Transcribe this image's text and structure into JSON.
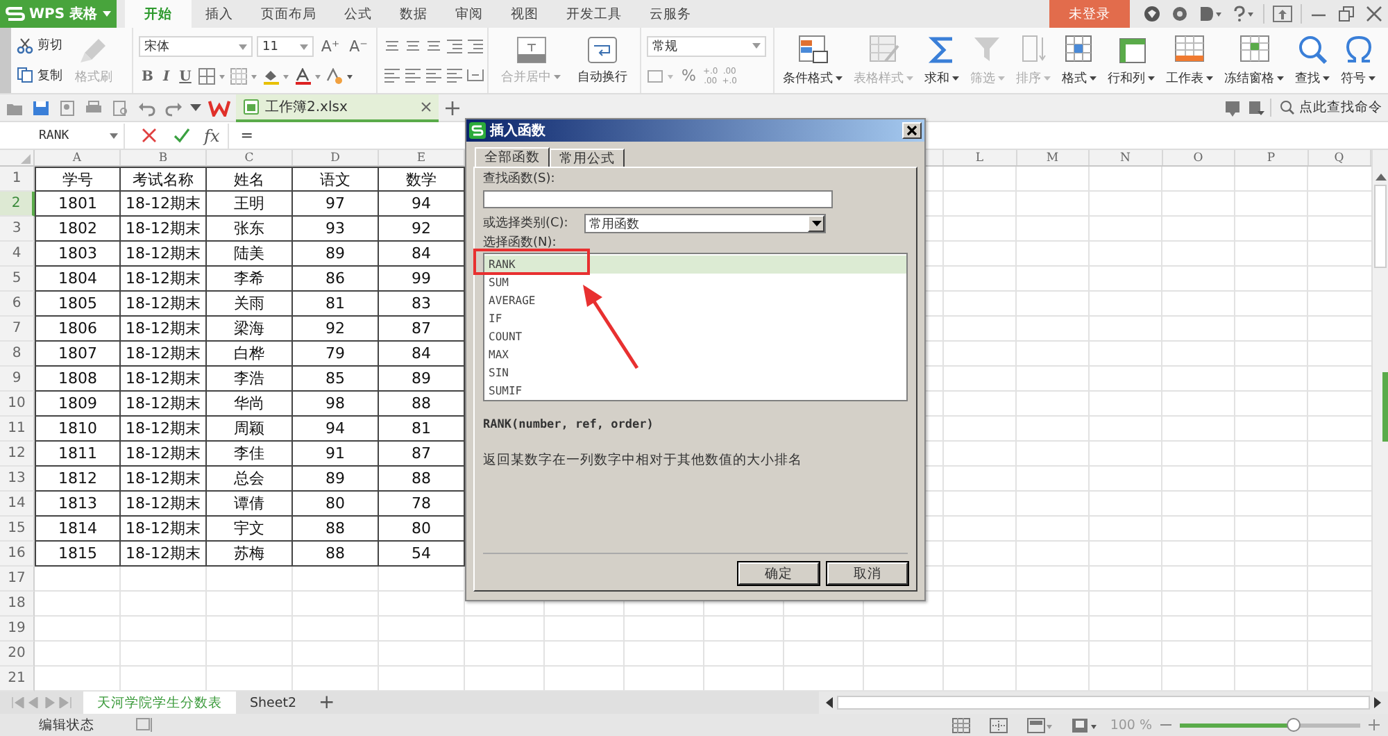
{
  "app": {
    "name": "WPS 表格"
  },
  "ribbon_tabs": [
    {
      "label": "开始",
      "selected": true
    },
    {
      "label": "插入",
      "selected": false
    },
    {
      "label": "页面布局",
      "selected": false
    },
    {
      "label": "公式",
      "selected": false
    },
    {
      "label": "数据",
      "selected": false
    },
    {
      "label": "审阅",
      "selected": false
    },
    {
      "label": "视图",
      "selected": false
    },
    {
      "label": "开发工具",
      "selected": false
    },
    {
      "label": "云服务",
      "selected": false
    }
  ],
  "account": {
    "label": "未登录"
  },
  "ribbon": {
    "clipboard": [
      {
        "label": "剪切",
        "kind": "cut",
        "disabled": false
      },
      {
        "label": "复制",
        "kind": "copy",
        "disabled": false
      }
    ],
    "format_painter": {
      "label": "格式刷",
      "disabled": true
    },
    "font": {
      "name": "宋体",
      "size": "11",
      "grow": "A⁺",
      "shrink": "A⁻"
    },
    "style_buttons": [
      "B",
      "I",
      "U"
    ],
    "merge": {
      "label": "合并居中",
      "disabled": true
    },
    "wrap": {
      "label": "自动换行",
      "disabled": false
    },
    "number": {
      "format": "常规",
      "percent": "%",
      "decimals": [
        {
          "top": "+.0",
          "bottom": ".00"
        },
        {
          "top": ".00",
          "bottom": "+.0"
        }
      ]
    },
    "tools": [
      {
        "label": "条件格式",
        "kind": "conditional",
        "disabled": false
      },
      {
        "label": "表格样式",
        "kind": "tablestyle",
        "disabled": true
      },
      {
        "label": "求和",
        "kind": "sum",
        "disabled": false
      },
      {
        "label": "筛选",
        "kind": "filter",
        "disabled": true
      },
      {
        "label": "排序",
        "kind": "sort",
        "disabled": true
      },
      {
        "label": "格式",
        "kind": "format",
        "disabled": false
      },
      {
        "label": "行和列",
        "kind": "rowcol",
        "disabled": false
      },
      {
        "label": "工作表",
        "kind": "sheet",
        "disabled": false
      },
      {
        "label": "冻结窗格",
        "kind": "freeze",
        "disabled": false
      },
      {
        "label": "查找",
        "kind": "find",
        "disabled": false
      },
      {
        "label": "符号",
        "kind": "symbol",
        "disabled": false
      }
    ],
    "command_search": {
      "placeholder": "点此查找命令"
    }
  },
  "document_tab": {
    "title": "工作簿2.xlsx"
  },
  "formula_bar": {
    "name_box": "RANK",
    "function_label": "fx",
    "formula": "="
  },
  "sheet": {
    "columns": [
      {
        "letter": "A"
      },
      {
        "letter": "B"
      },
      {
        "letter": "C"
      },
      {
        "letter": "D"
      },
      {
        "letter": "E"
      }
    ],
    "right_columns": [
      {
        "letter": "L"
      },
      {
        "letter": "M"
      },
      {
        "letter": "N"
      },
      {
        "letter": "O"
      },
      {
        "letter": "P"
      },
      {
        "letter": "Q"
      }
    ],
    "rows": [
      {
        "number": "1",
        "selected": false,
        "cells": [
          "学号",
          "考试名称",
          "姓名",
          "语文",
          "数学"
        ]
      },
      {
        "number": "2",
        "selected": true,
        "cells": [
          "1801",
          "18-12期末",
          "王明",
          "97",
          "94"
        ]
      },
      {
        "number": "3",
        "selected": false,
        "cells": [
          "1802",
          "18-12期末",
          "张东",
          "93",
          "92"
        ]
      },
      {
        "number": "4",
        "selected": false,
        "cells": [
          "1803",
          "18-12期末",
          "陆美",
          "89",
          "84"
        ]
      },
      {
        "number": "5",
        "selected": false,
        "cells": [
          "1804",
          "18-12期末",
          "李希",
          "86",
          "99"
        ]
      },
      {
        "number": "6",
        "selected": false,
        "cells": [
          "1805",
          "18-12期末",
          "关雨",
          "81",
          "83"
        ]
      },
      {
        "number": "7",
        "selected": false,
        "cells": [
          "1806",
          "18-12期末",
          "梁海",
          "92",
          "87"
        ]
      },
      {
        "number": "8",
        "selected": false,
        "cells": [
          "1807",
          "18-12期末",
          "白桦",
          "79",
          "84"
        ]
      },
      {
        "number": "9",
        "selected": false,
        "cells": [
          "1808",
          "18-12期末",
          "李浩",
          "85",
          "89"
        ]
      },
      {
        "number": "10",
        "selected": false,
        "cells": [
          "1809",
          "18-12期末",
          "华尚",
          "98",
          "88"
        ]
      },
      {
        "number": "11",
        "selected": false,
        "cells": [
          "1810",
          "18-12期末",
          "周颖",
          "94",
          "81"
        ]
      },
      {
        "number": "12",
        "selected": false,
        "cells": [
          "1811",
          "18-12期末",
          "李佳",
          "91",
          "87"
        ]
      },
      {
        "number": "13",
        "selected": false,
        "cells": [
          "1812",
          "18-12期末",
          "总会",
          "89",
          "88"
        ]
      },
      {
        "number": "14",
        "selected": false,
        "cells": [
          "1813",
          "18-12期末",
          "谭倩",
          "80",
          "78"
        ]
      },
      {
        "number": "15",
        "selected": false,
        "cells": [
          "1814",
          "18-12期末",
          "宇文",
          "88",
          "80"
        ]
      },
      {
        "number": "16",
        "selected": false,
        "cells": [
          "1815",
          "18-12期末",
          "苏梅",
          "88",
          "54"
        ]
      },
      {
        "number": "17",
        "selected": false
      },
      {
        "number": "18",
        "selected": false
      },
      {
        "number": "19",
        "selected": false
      },
      {
        "number": "20",
        "selected": false
      },
      {
        "number": "21",
        "selected": false
      }
    ]
  },
  "dialog": {
    "title": "插入函数",
    "tabs": [
      {
        "label": "全部函数",
        "selected": true
      },
      {
        "label": "常用公式",
        "selected": false
      }
    ],
    "search_label": "查找函数(S):",
    "category_label": "或选择类别(C):",
    "category": "常用函数",
    "list_label": "选择函数(N):",
    "functions": [
      {
        "name": "RANK",
        "selected": true
      },
      {
        "name": "SUM",
        "selected": false
      },
      {
        "name": "AVERAGE",
        "selected": false
      },
      {
        "name": "IF",
        "selected": false
      },
      {
        "name": "COUNT",
        "selected": false
      },
      {
        "name": "MAX",
        "selected": false
      },
      {
        "name": "SIN",
        "selected": false
      },
      {
        "name": "SUMIF",
        "selected": false
      }
    ],
    "signature": "RANK(number, ref, order)",
    "description": "返回某数字在一列数字中相对于其他数值的大小排名",
    "buttons": [
      "确定",
      "取消"
    ]
  },
  "sheet_tabs": [
    {
      "label": "天河学院学生分数表",
      "selected": true
    },
    {
      "label": "Sheet2",
      "selected": false
    }
  ],
  "add_sheet": "+",
  "status_bar": {
    "mode": "编辑状态",
    "zoom": "100 %",
    "level": 0.63
  }
}
